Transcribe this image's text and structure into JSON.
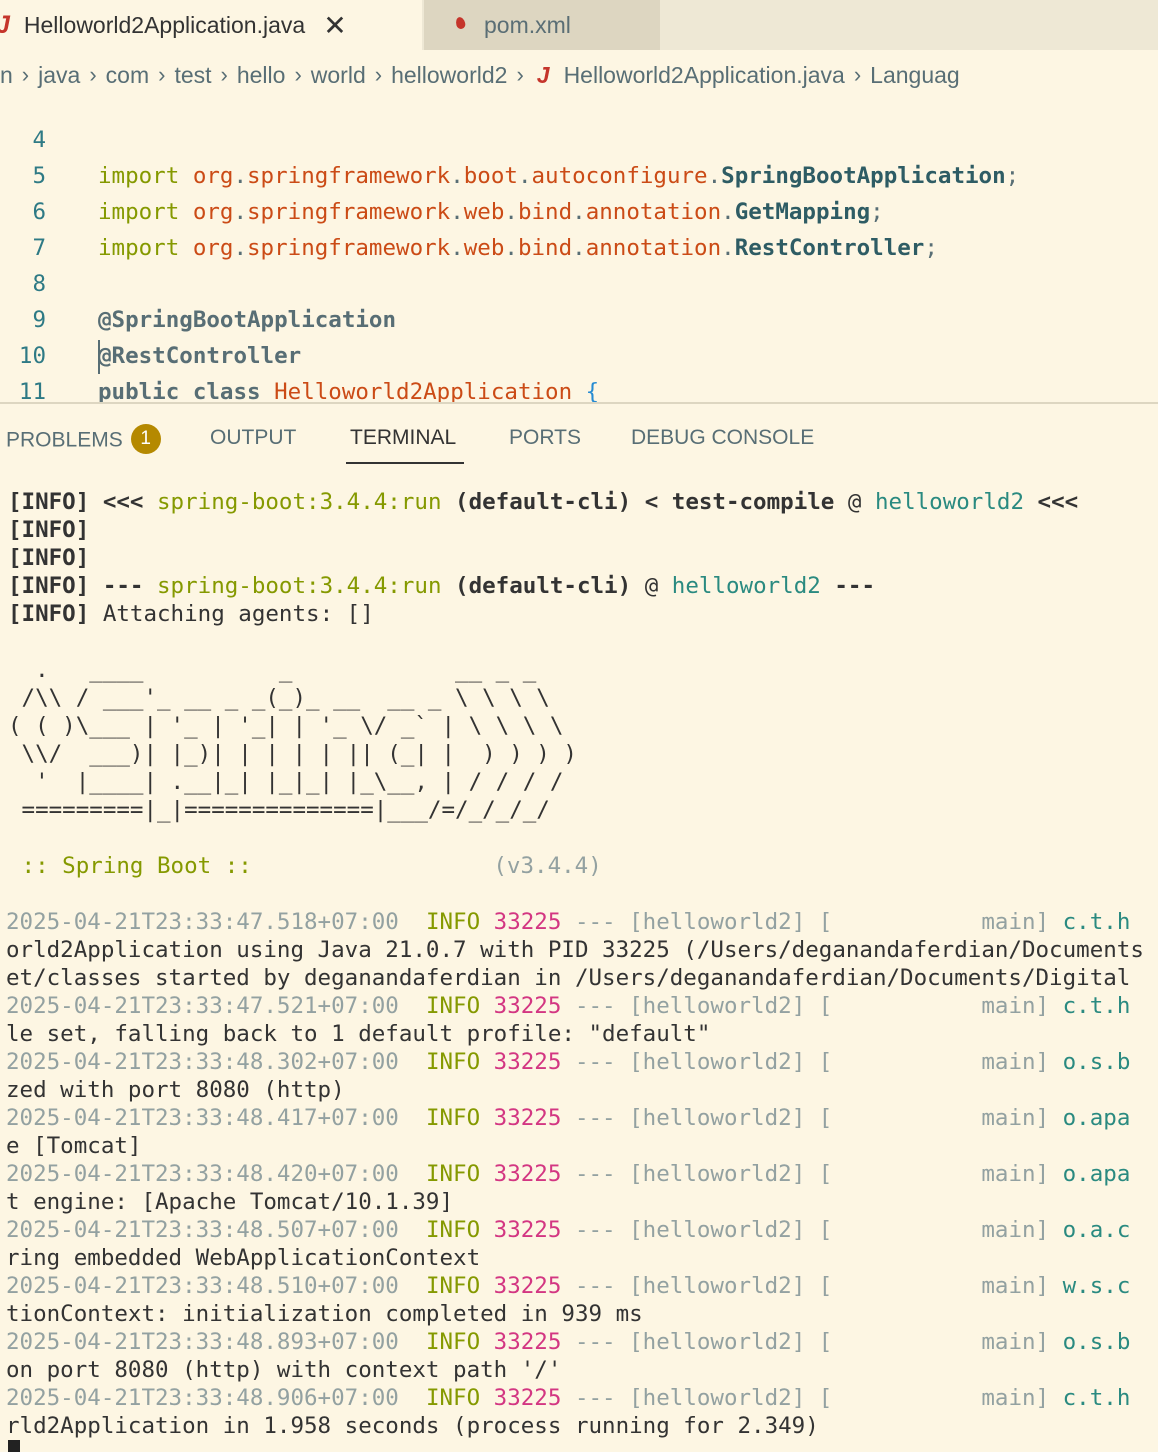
{
  "tabs": [
    {
      "label": "Helloworld2Application.java",
      "icon": "J",
      "close": "✕"
    },
    {
      "label": "pom.xml"
    }
  ],
  "breadcrumb": [
    "n",
    "java",
    "com",
    "test",
    "hello",
    "world",
    "helloworld2",
    "Helloworld2Application.java",
    "Languag"
  ],
  "breadcrumb_java_icon": "J",
  "breadcrumb_sep": "›",
  "editor": {
    "lines": [
      {
        "num": "4",
        "kw": "import",
        "pkg": [
          "org",
          "springframework",
          "boot",
          "autoconfigure"
        ],
        "cls": "SpringBootApplication"
      },
      {
        "num": "5",
        "kw": "import",
        "pkg": [
          "org",
          "springframework",
          "web",
          "bind",
          "annotation"
        ],
        "cls": "GetMapping"
      },
      {
        "num": "6",
        "kw": "import",
        "pkg": [
          "org",
          "springframework",
          "web",
          "bind",
          "annotation"
        ],
        "cls": "RestController"
      },
      {
        "num": "7"
      },
      {
        "num": "8",
        "annotation": "@SpringBootApplication"
      },
      {
        "num": "9",
        "annotation": "@RestController"
      },
      {
        "num": "10",
        "decl_kw": "public class",
        "decl_name": "Helloworld2Application",
        "brace": "{"
      },
      {
        "num": "11"
      }
    ]
  },
  "panel": {
    "tabs": [
      "PROBLEMS",
      "OUTPUT",
      "TERMINAL",
      "PORTS",
      "DEBUG CONSOLE"
    ],
    "problems_count": "1",
    "active": "TERMINAL"
  },
  "terminal": {
    "info_tag": "[INFO]",
    "maven": {
      "line1": {
        "a": "<<<",
        "goal": "spring-boot:3.4.4:run",
        "b": "(default-cli) < test-compile",
        "at": "@",
        "project": "helloworld2",
        "c": "<<<"
      },
      "line4": {
        "a": "---",
        "goal": "spring-boot:3.4.4:run",
        "b": "(default-cli)",
        "at": "@",
        "project": "helloworld2",
        "c": "---"
      },
      "line5": "Attaching agents: []"
    },
    "banner": [
      "  .   ____          _            __ _ _",
      " /\\\\ / ___'_ __ _ _(_)_ __  __ _ \\ \\ \\ \\",
      "( ( )\\___ | '_ | '_| | '_ \\/ _` | \\ \\ \\ \\",
      " \\\\/  ___)| |_)| | | | | || (_| |  ) ) ) )",
      "  '  |____| .__|_| |_|_| |_\\__, | / / / /",
      " =========|_|==============|___/=/_/_/_/"
    ],
    "boot_label": " :: Spring Boot :: ",
    "boot_version": "(v3.4.4)",
    "logs": [
      {
        "ts": "2025-04-21T23:33:47.518+07:00",
        "level": "INFO",
        "pid": "33225",
        "sep": "---",
        "app": "[helloworld2]",
        "thread": "[           main]",
        "logger": "c.t.h",
        "cont": "orld2Application using Java 21.0.7 with PID 33225 (/Users/deganandaferdian/Documents",
        "cont2": "et/classes started by deganandaferdian in /Users/deganandaferdian/Documents/Digital"
      },
      {
        "ts": "2025-04-21T23:33:47.521+07:00",
        "level": "INFO",
        "pid": "33225",
        "sep": "---",
        "app": "[helloworld2]",
        "thread": "[           main]",
        "logger": "c.t.h",
        "cont": "le set, falling back to 1 default profile: \"default\""
      },
      {
        "ts": "2025-04-21T23:33:48.302+07:00",
        "level": "INFO",
        "pid": "33225",
        "sep": "---",
        "app": "[helloworld2]",
        "thread": "[           main]",
        "logger": "o.s.b",
        "cont": "zed with port 8080 (http)"
      },
      {
        "ts": "2025-04-21T23:33:48.417+07:00",
        "level": "INFO",
        "pid": "33225",
        "sep": "---",
        "app": "[helloworld2]",
        "thread": "[           main]",
        "logger": "o.apa",
        "cont": "e [Tomcat]"
      },
      {
        "ts": "2025-04-21T23:33:48.420+07:00",
        "level": "INFO",
        "pid": "33225",
        "sep": "---",
        "app": "[helloworld2]",
        "thread": "[           main]",
        "logger": "o.apa",
        "cont": "t engine: [Apache Tomcat/10.1.39]"
      },
      {
        "ts": "2025-04-21T23:33:48.507+07:00",
        "level": "INFO",
        "pid": "33225",
        "sep": "---",
        "app": "[helloworld2]",
        "thread": "[           main]",
        "logger": "o.a.c",
        "cont": "ring embedded WebApplicationContext"
      },
      {
        "ts": "2025-04-21T23:33:48.510+07:00",
        "level": "INFO",
        "pid": "33225",
        "sep": "---",
        "app": "[helloworld2]",
        "thread": "[           main]",
        "logger": "w.s.c",
        "cont": "tionContext: initialization completed in 939 ms"
      },
      {
        "ts": "2025-04-21T23:33:48.893+07:00",
        "level": "INFO",
        "pid": "33225",
        "sep": "---",
        "app": "[helloworld2]",
        "thread": "[           main]",
        "logger": "o.s.b",
        "cont": "on port 8080 (http) with context path '/'"
      },
      {
        "ts": "2025-04-21T23:33:48.906+07:00",
        "level": "INFO",
        "pid": "33225",
        "sep": "---",
        "app": "[helloworld2]",
        "thread": "[           main]",
        "logger": "c.t.h",
        "cont": "rld2Application in 1.958 seconds (process running for 2.349)"
      }
    ]
  }
}
